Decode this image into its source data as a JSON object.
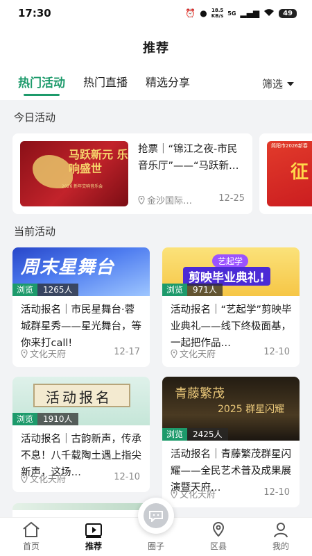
{
  "status": {
    "time": "17:30",
    "speed_value": "18.5",
    "speed_unit": "KB/s",
    "network": "5G",
    "battery": "49"
  },
  "header": {
    "title": "推荐"
  },
  "tabs": [
    {
      "label": "热门活动",
      "active": true
    },
    {
      "label": "热门直播",
      "active": false
    },
    {
      "label": "精选分享",
      "active": false
    }
  ],
  "filter": {
    "label": "筛选"
  },
  "today": {
    "section_title": "今日活动",
    "card": {
      "title": "抢票｜“锦江之夜-市民音乐厅”——“马跃新…",
      "location": "金沙国际…",
      "date": "12-25",
      "image_text_main": "马跃新元 乐响盛世",
      "image_text_sub": "2026 新年交响音乐会"
    },
    "card2": {
      "image_text_top": "简阳市2026新春",
      "image_text_main": "征"
    }
  },
  "current": {
    "section_title": "当前活动",
    "cards": [
      {
        "image_text": "周末星舞台",
        "views_label": "浏览",
        "views": "1265人",
        "title": "活动报名｜市民星舞台·蓉城群星秀——星光舞台，等你来打call!",
        "location": "文化天府",
        "date": "12-17"
      },
      {
        "image_text": "剪映毕业典礼!",
        "image_badge": "艺起学",
        "views_label": "浏览",
        "views": "971人",
        "title": "活动报名｜“艺起学”剪映毕业典礼——线下终极面基，一起把作品…",
        "location": "文化天府",
        "date": "12-10"
      },
      {
        "image_text": "活动报名",
        "views_label": "浏览",
        "views": "1910人",
        "title": "活动报名｜古韵新声，传承不息！八千载陶土遇上指尖新声，这场…",
        "location": "文化天府",
        "date": "12-10"
      },
      {
        "image_text": "青藤繁茂",
        "image_text2": "2025 群星闪耀",
        "views_label": "浏览",
        "views": "2425人",
        "title": "活动报名｜青藤繁茂群星闪耀——全民艺术普及成果展演暨天府…",
        "location": "文化天府",
        "date": "12-10"
      }
    ]
  },
  "bottom_nav": [
    {
      "label": "首页",
      "icon": "home-icon",
      "active": false
    },
    {
      "label": "推荐",
      "icon": "play-icon",
      "active": true
    },
    {
      "label": "圈子",
      "icon": "circle-icon",
      "active": false
    },
    {
      "label": "区县",
      "icon": "location-icon",
      "active": false
    },
    {
      "label": "我的",
      "icon": "user-icon",
      "active": false
    }
  ],
  "colors": {
    "accent": "#1d9a6b",
    "background": "#f2f3f5"
  }
}
